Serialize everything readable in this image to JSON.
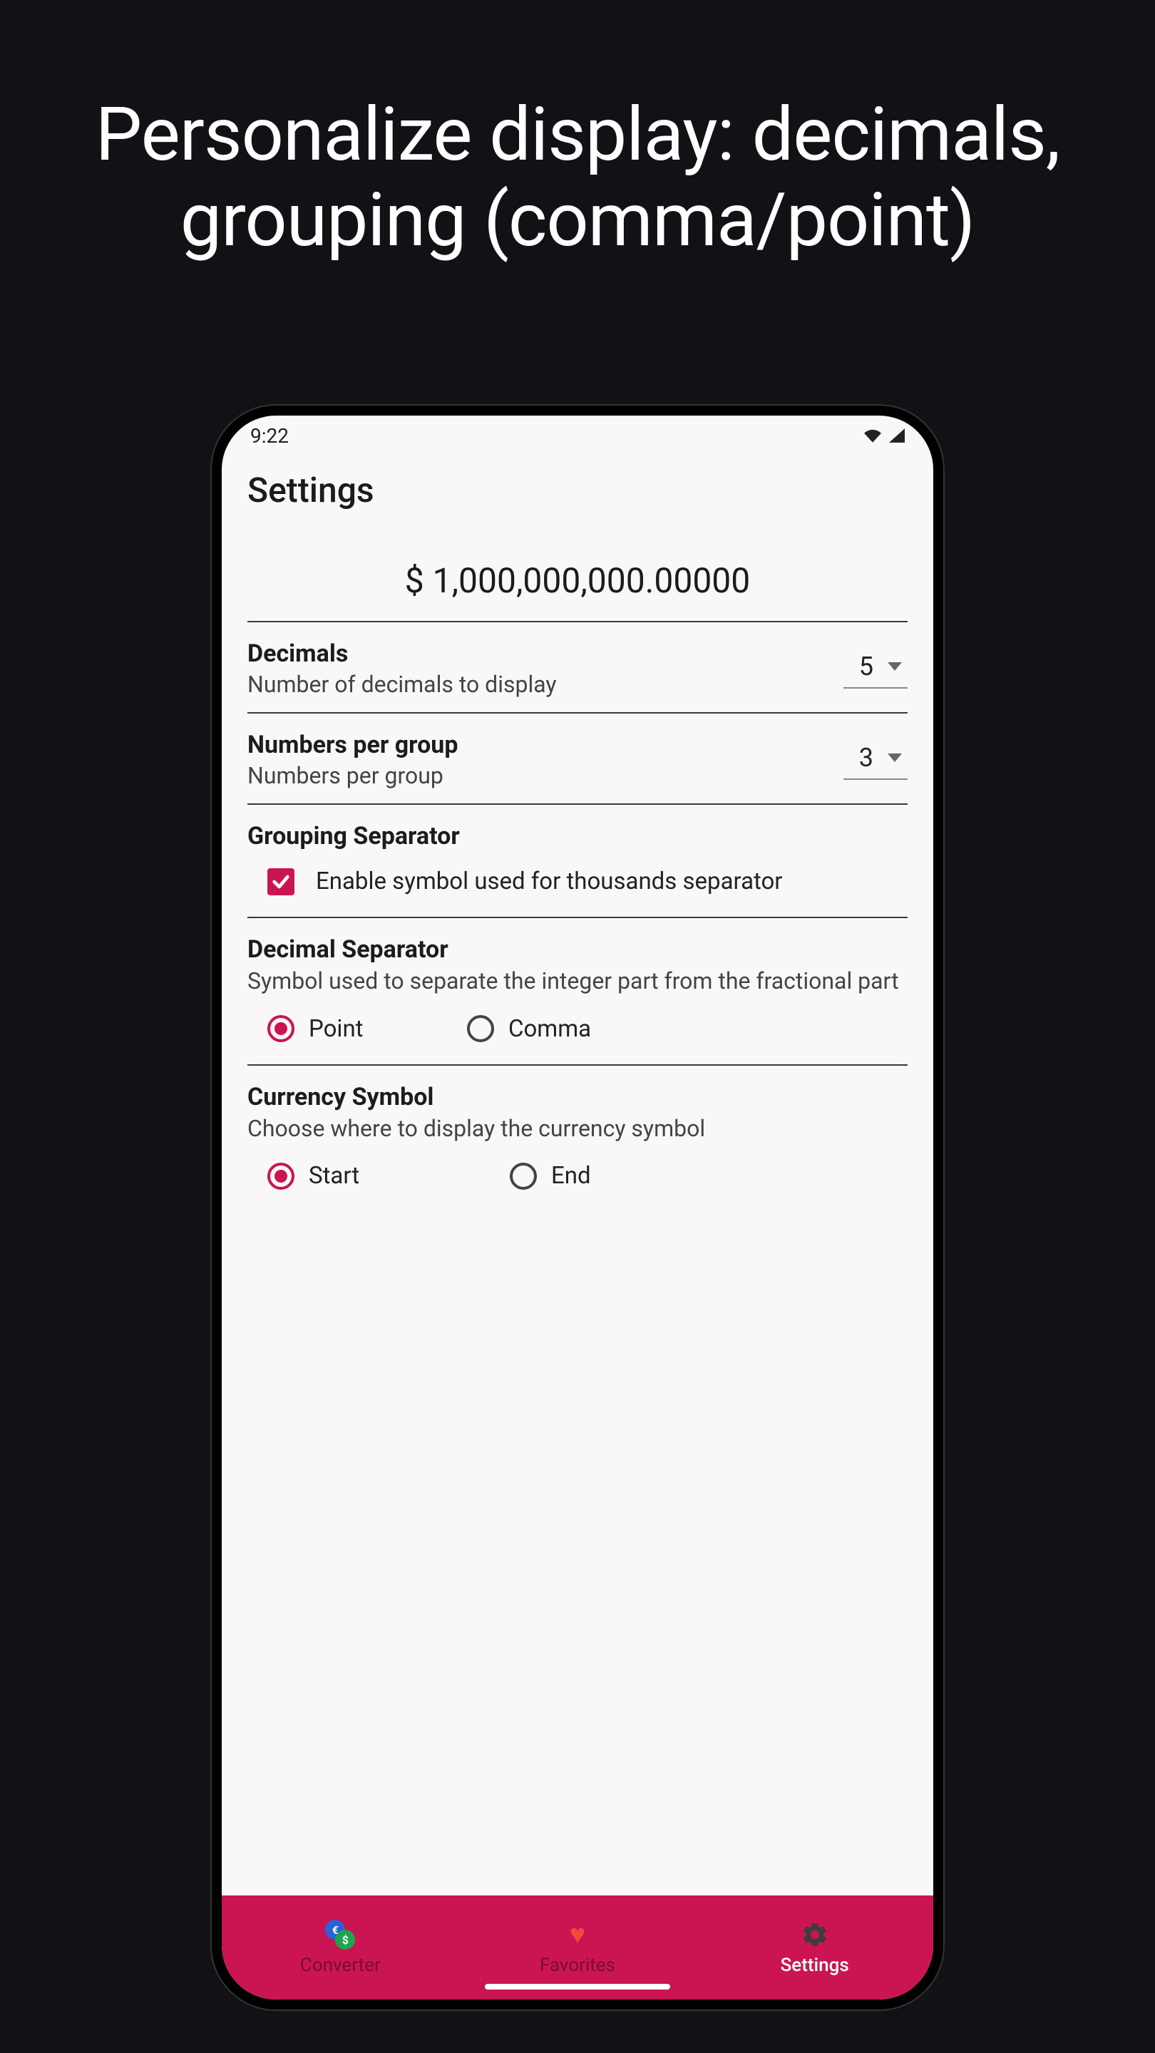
{
  "promo": {
    "headline_l1": "Personalize display: decimals,",
    "headline_l2": "grouping (comma/point)"
  },
  "statusbar": {
    "time": "9:22"
  },
  "page": {
    "title": "Settings"
  },
  "preview": {
    "value": "$ 1,000,000,000.00000"
  },
  "decimals": {
    "label": "Decimals",
    "sub": "Number of decimals to display",
    "value": "5"
  },
  "groups": {
    "label": "Numbers per group",
    "sub": "Numbers per group",
    "value": "3"
  },
  "groupsep": {
    "title": "Grouping Separator",
    "checkbox_label": "Enable symbol used for thousands separator"
  },
  "decsep": {
    "title": "Decimal Separator",
    "sub": "Symbol used to separate the integer part from the fractional part",
    "opt_point": "Point",
    "opt_comma": "Comma"
  },
  "cursym": {
    "title": "Currency Symbol",
    "sub": "Choose where to display the currency symbol",
    "opt_start": "Start",
    "opt_end": "End"
  },
  "nav": {
    "converter": "Converter",
    "favorites": "Favorites",
    "settings": "Settings"
  },
  "colors": {
    "accent": "#cb1552"
  }
}
